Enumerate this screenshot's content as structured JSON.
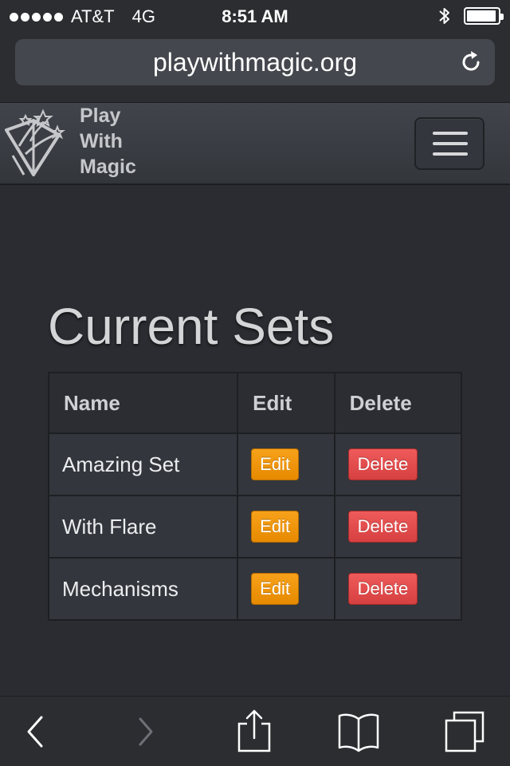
{
  "status_bar": {
    "carrier": "AT&T",
    "network": "4G",
    "time": "8:51 AM",
    "battery_level": 0.95
  },
  "browser": {
    "url": "playwithmagic.org"
  },
  "navbar": {
    "brand_line1": "Play",
    "brand_line2": "With",
    "brand_line3": "Magic"
  },
  "main": {
    "title": "Current Sets",
    "table": {
      "headers": [
        "Name",
        "Edit",
        "Delete"
      ],
      "rows": [
        {
          "name": "Amazing Set",
          "edit_label": "Edit",
          "delete_label": "Delete"
        },
        {
          "name": "With Flare",
          "edit_label": "Edit",
          "delete_label": "Delete"
        },
        {
          "name": "Mechanisms",
          "edit_label": "Edit",
          "delete_label": "Delete"
        }
      ]
    }
  },
  "colors": {
    "edit_button": "#f39c12",
    "delete_button": "#e74c4c",
    "background": "#2a2c31"
  },
  "icons": {
    "toolbar": [
      "back-icon",
      "forward-icon",
      "share-icon",
      "bookmarks-icon",
      "tabs-icon"
    ]
  }
}
